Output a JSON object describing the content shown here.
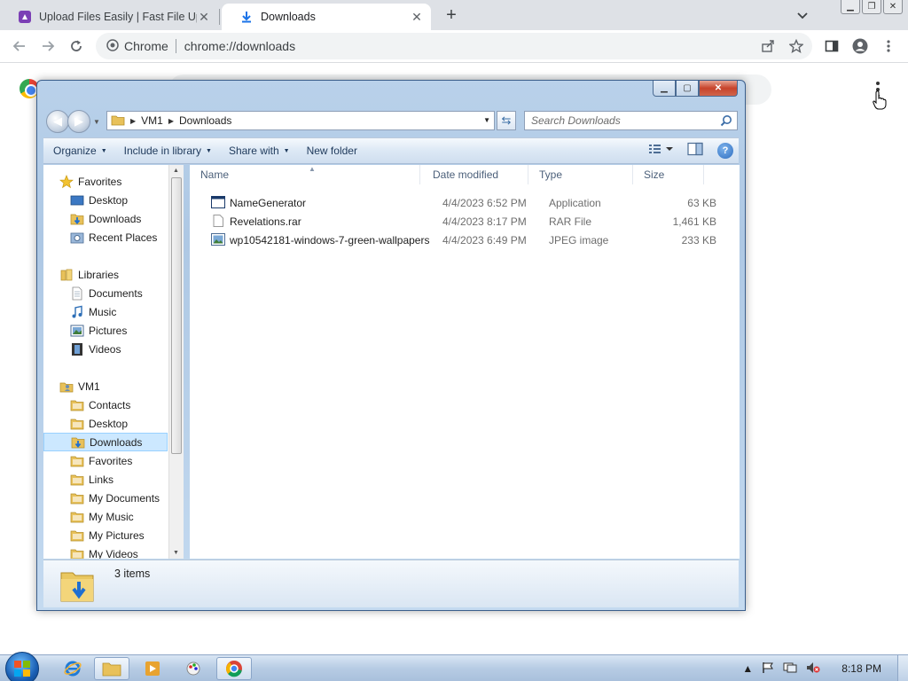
{
  "browser": {
    "tabs": [
      {
        "title": "Upload Files Easily | Fast File Uplc",
        "active": false
      },
      {
        "title": "Downloads",
        "active": true
      }
    ],
    "omnibox": {
      "label": "Chrome",
      "url": "chrome://downloads"
    }
  },
  "explorer": {
    "breadcrumb": [
      "VM1",
      "Downloads"
    ],
    "search_placeholder": "Search Downloads",
    "commands": {
      "organize": "Organize",
      "include_in_library": "Include in library",
      "share_with": "Share with",
      "new_folder": "New folder"
    },
    "nav_tree": [
      {
        "label": "Favorites",
        "level": 0,
        "icon": "star-icon"
      },
      {
        "label": "Desktop",
        "level": 1,
        "icon": "desktop-icon"
      },
      {
        "label": "Downloads",
        "level": 1,
        "icon": "downloads-folder-icon"
      },
      {
        "label": "Recent Places",
        "level": 1,
        "icon": "recent-places-icon"
      },
      {
        "label": "Libraries",
        "level": 0,
        "icon": "libraries-icon"
      },
      {
        "label": "Documents",
        "level": 1,
        "icon": "documents-icon"
      },
      {
        "label": "Music",
        "level": 1,
        "icon": "music-icon"
      },
      {
        "label": "Pictures",
        "level": 1,
        "icon": "pictures-icon"
      },
      {
        "label": "Videos",
        "level": 1,
        "icon": "videos-icon"
      },
      {
        "label": "VM1",
        "level": 0,
        "icon": "user-folder-icon"
      },
      {
        "label": "Contacts",
        "level": 1,
        "icon": "contacts-icon"
      },
      {
        "label": "Desktop",
        "level": 1,
        "icon": "desktop-folder-icon"
      },
      {
        "label": "Downloads",
        "level": 1,
        "icon": "downloads-folder-icon",
        "selected": true
      },
      {
        "label": "Favorites",
        "level": 1,
        "icon": "favorites-folder-icon"
      },
      {
        "label": "Links",
        "level": 1,
        "icon": "links-folder-icon"
      },
      {
        "label": "My Documents",
        "level": 1,
        "icon": "documents-folder-icon"
      },
      {
        "label": "My Music",
        "level": 1,
        "icon": "music-folder-icon"
      },
      {
        "label": "My Pictures",
        "level": 1,
        "icon": "pictures-folder-icon"
      },
      {
        "label": "My Videos",
        "level": 1,
        "icon": "videos-folder-icon"
      }
    ],
    "columns": {
      "name": "Name",
      "date": "Date modified",
      "type": "Type",
      "size": "Size"
    },
    "files": [
      {
        "name": "NameGenerator",
        "date": "4/4/2023 6:52 PM",
        "type": "Application",
        "size": "63 KB",
        "icon": "application-icon"
      },
      {
        "name": "Revelations.rar",
        "date": "4/4/2023 8:17 PM",
        "type": "RAR File",
        "size": "1,461 KB",
        "icon": "file-icon"
      },
      {
        "name": "wp10542181-windows-7-green-wallpapers",
        "date": "4/4/2023 6:49 PM",
        "type": "JPEG image",
        "size": "233 KB",
        "icon": "image-icon"
      }
    ],
    "details": {
      "item_count": "3 items"
    }
  },
  "taskbar": {
    "clock": "8:18 PM",
    "apps": [
      "internet-explorer-icon",
      "file-explorer-icon",
      "media-player-icon",
      "paint-icon",
      "chrome-icon"
    ]
  }
}
